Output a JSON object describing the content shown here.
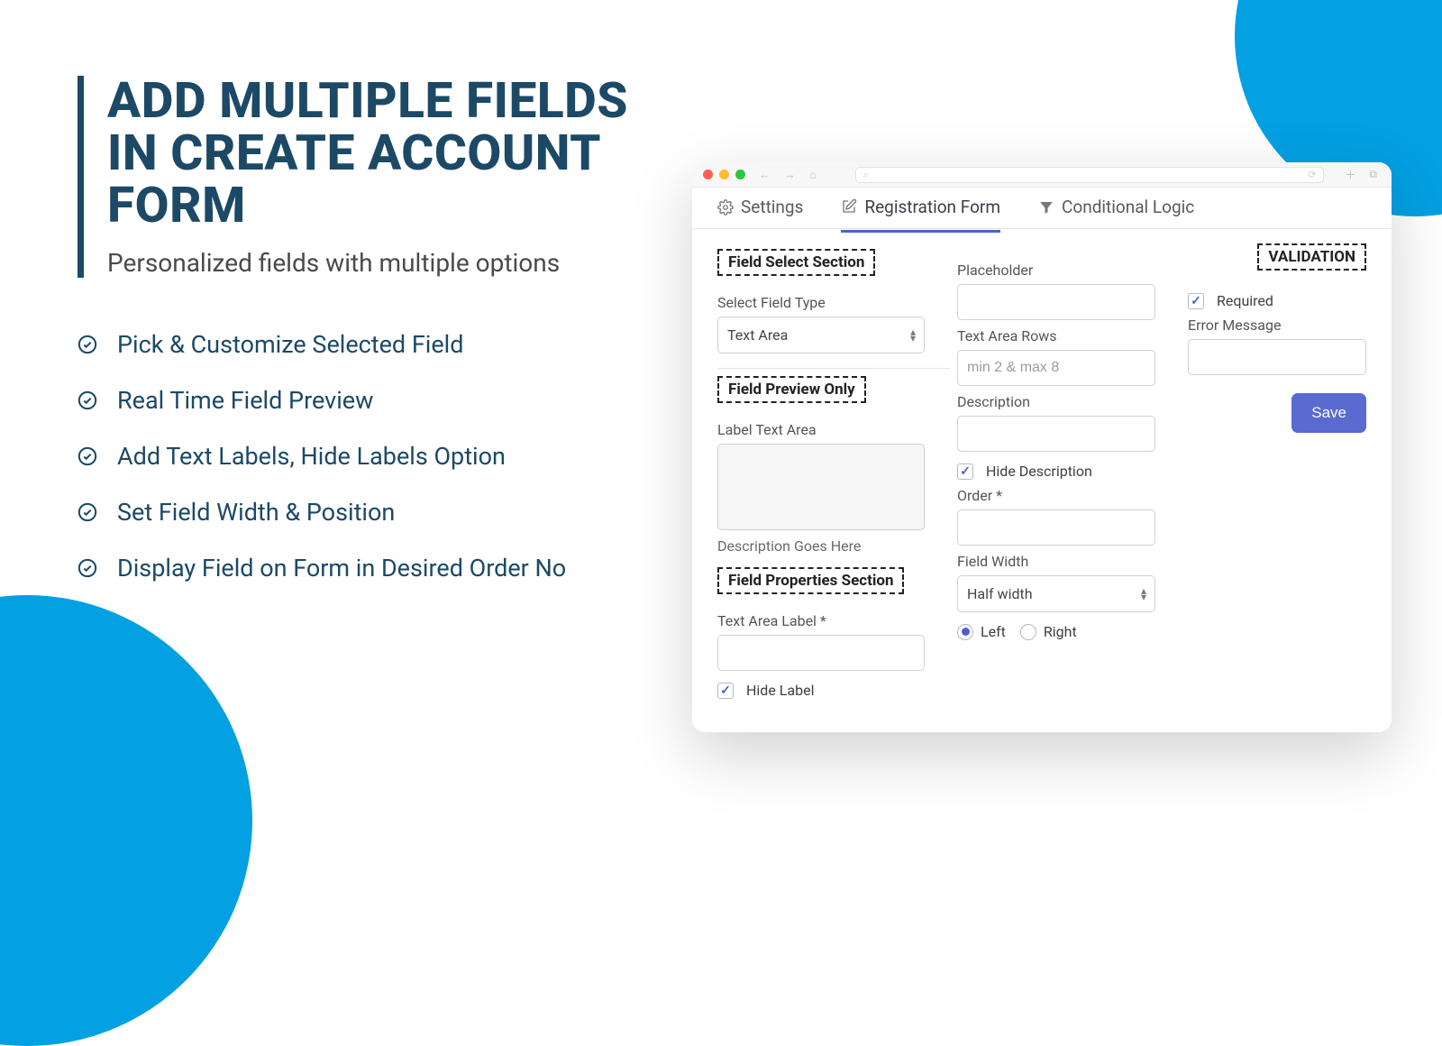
{
  "heading": "ADD MULTIPLE FIELDS IN CREATE ACCOUNT FORM",
  "subheading": "Personalized fields with multiple options",
  "bullets": [
    "Pick & Customize Selected Field",
    "Real Time Field Preview",
    "Add Text Labels, Hide Labels Option",
    "Set Field Width & Position",
    "Display Field on Form in Desired Order No"
  ],
  "tabs": {
    "settings": "Settings",
    "registration": "Registration Form",
    "conditional": "Conditional Logic"
  },
  "col1": {
    "section_field_select": "Field Select Section",
    "select_field_type_lbl": "Select Field Type",
    "select_field_type_value": "Text Area",
    "section_preview": "Field Preview Only",
    "label_text_area_lbl": "Label Text Area",
    "desc_goes_here": "Description Goes Here",
    "section_properties": "Field Properties Section",
    "text_area_label_lbl": "Text Area Label *",
    "hide_label": "Hide Label"
  },
  "col2": {
    "placeholder_lbl": "Placeholder",
    "rows_lbl": "Text Area Rows",
    "rows_placeholder": "min 2 & max 8",
    "description_lbl": "Description",
    "hide_description": "Hide Description",
    "order_lbl": "Order *",
    "width_lbl": "Field Width",
    "width_value": "Half width",
    "left": "Left",
    "right": "Right"
  },
  "col3": {
    "validation": "VALIDATION",
    "required": "Required",
    "error_lbl": "Error Message",
    "save": "Save"
  }
}
